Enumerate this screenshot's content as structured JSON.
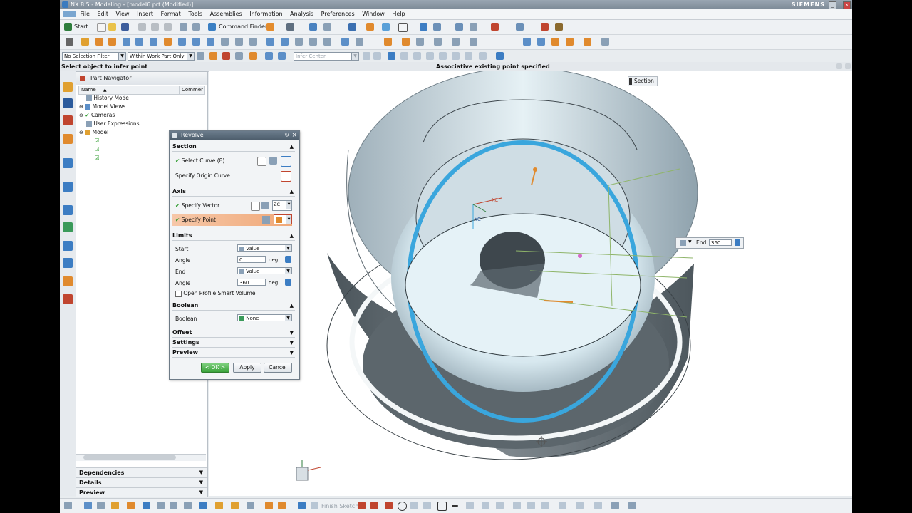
{
  "window": {
    "title": "NX 8.5 - Modeling - [model6.prt (Modified)]",
    "brand": "SIEMENS"
  },
  "menu": [
    "File",
    "Edit",
    "View",
    "Insert",
    "Format",
    "Tools",
    "Assemblies",
    "Information",
    "Analysis",
    "Preferences",
    "Window",
    "Help"
  ],
  "toolbar": {
    "start_label": "Start",
    "command_finder_label": "Command Finder"
  },
  "filters": {
    "selection_filter": "No Selection Filter",
    "scope": "Within Work Part Only",
    "infer_center": "Infer Center"
  },
  "status": {
    "left": "Select object to infer point",
    "center": "Associative existing point specified"
  },
  "navigator": {
    "title": "Part Navigator",
    "columns": [
      "Name",
      "Commer"
    ],
    "items": [
      "History Mode",
      "Model Views",
      "Cameras",
      "User Expressions",
      "Model"
    ],
    "sections": [
      "Dependencies",
      "Details",
      "Preview"
    ]
  },
  "viewport": {
    "section_label": "Section",
    "end_label": "End",
    "end_value": "360",
    "csys_xc": "XC",
    "csys_yc": "YC"
  },
  "dialog": {
    "title": "Revolve",
    "section": {
      "header": "Section",
      "select_curve": "Select Curve (8)",
      "origin_curve": "Specify Origin Curve"
    },
    "axis": {
      "header": "Axis",
      "vector": "Specify Vector",
      "point": "Specify Point",
      "zc": "ZC"
    },
    "limits": {
      "header": "Limits",
      "start_label": "Start",
      "start_value": "Value",
      "angle1_label": "Angle",
      "angle1_value": "0",
      "angle1_unit": "deg",
      "end_label": "End",
      "end_value": "Value",
      "angle2_label": "Angle",
      "angle2_value": "360",
      "angle2_unit": "deg",
      "open_profile": "Open Profile Smart Volume"
    },
    "boolean": {
      "header": "Boolean",
      "label": "Boolean",
      "value": "None"
    },
    "offset": "Offset",
    "settings": "Settings",
    "preview": "Preview",
    "buttons": {
      "ok": "< OK >",
      "apply": "Apply",
      "cancel": "Cancel"
    }
  },
  "bottom_toolbar": {
    "finish_sketch": "Finish Sketch"
  },
  "colors": {
    "title_bar": "#7d8a97",
    "dialog_title": "#55667a",
    "highlight_row": "#f0a878",
    "accent_blue": "#3aa6dd",
    "part_gray": "#6a747b"
  }
}
